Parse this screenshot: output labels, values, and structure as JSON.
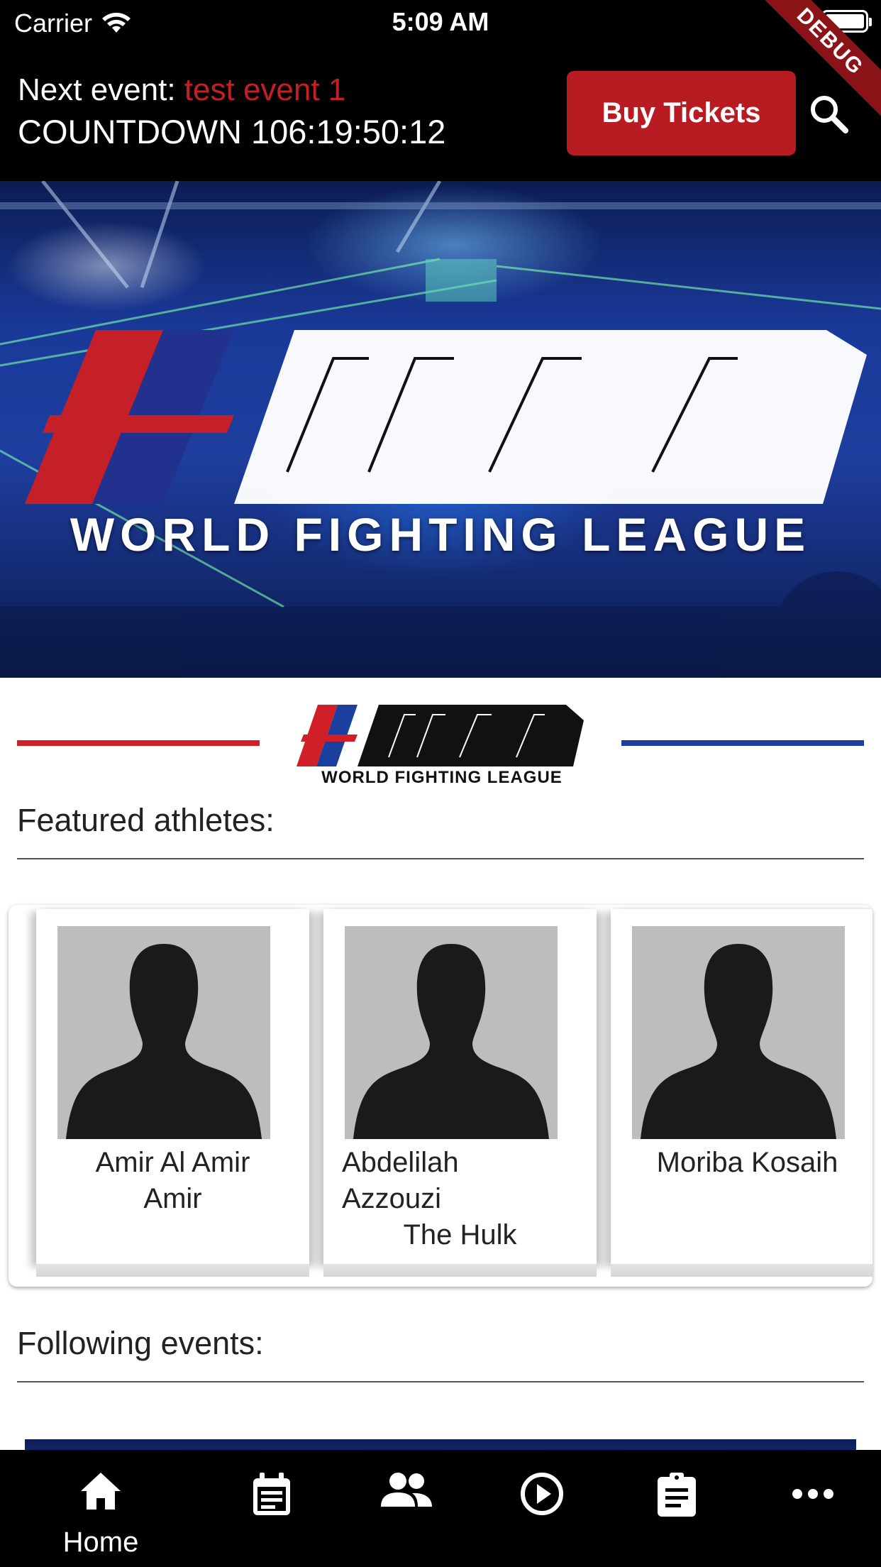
{
  "status_bar": {
    "carrier": "Carrier",
    "time": "5:09 AM"
  },
  "debug_ribbon": "DEBUG",
  "header": {
    "next_event_label": "Next event:",
    "next_event_name": "test event 1",
    "countdown_label": "COUNTDOWN",
    "countdown_value": "106:19:50:12",
    "buy_tickets_label": "Buy Tickets",
    "search_icon": "search-icon"
  },
  "hero": {
    "logo_text": "WFL",
    "tagline": "WORLD FIGHTING LEAGUE"
  },
  "brand": {
    "logo_text": "WFL",
    "tagline": "WORLD FIGHTING LEAGUE",
    "colors": {
      "red": "#d01f26",
      "blue": "#1b3f9f"
    }
  },
  "featured": {
    "title": "Featured athletes:",
    "athletes": [
      {
        "name_line1": "Amir Al Amir",
        "name_line2": "Amir",
        "nickname": ""
      },
      {
        "name_line1": "Abdelilah",
        "name_line2": "Azzouzi",
        "nickname": "The Hulk"
      },
      {
        "name_line1": "Moriba Kosaih",
        "name_line2": "",
        "nickname": ""
      }
    ]
  },
  "following": {
    "title": "Following events:"
  },
  "bottom_nav": {
    "items": [
      {
        "icon": "home-icon",
        "label": "Home",
        "active": true
      },
      {
        "icon": "calendar-icon",
        "label": "",
        "active": false
      },
      {
        "icon": "people-icon",
        "label": "",
        "active": false
      },
      {
        "icon": "play-icon",
        "label": "",
        "active": false
      },
      {
        "icon": "clipboard-icon",
        "label": "",
        "active": false
      },
      {
        "icon": "more-icon",
        "label": "",
        "active": false
      }
    ]
  },
  "colors": {
    "accent_red": "#b81c22",
    "event_name_red": "#c32026",
    "header_bg": "#000000"
  }
}
